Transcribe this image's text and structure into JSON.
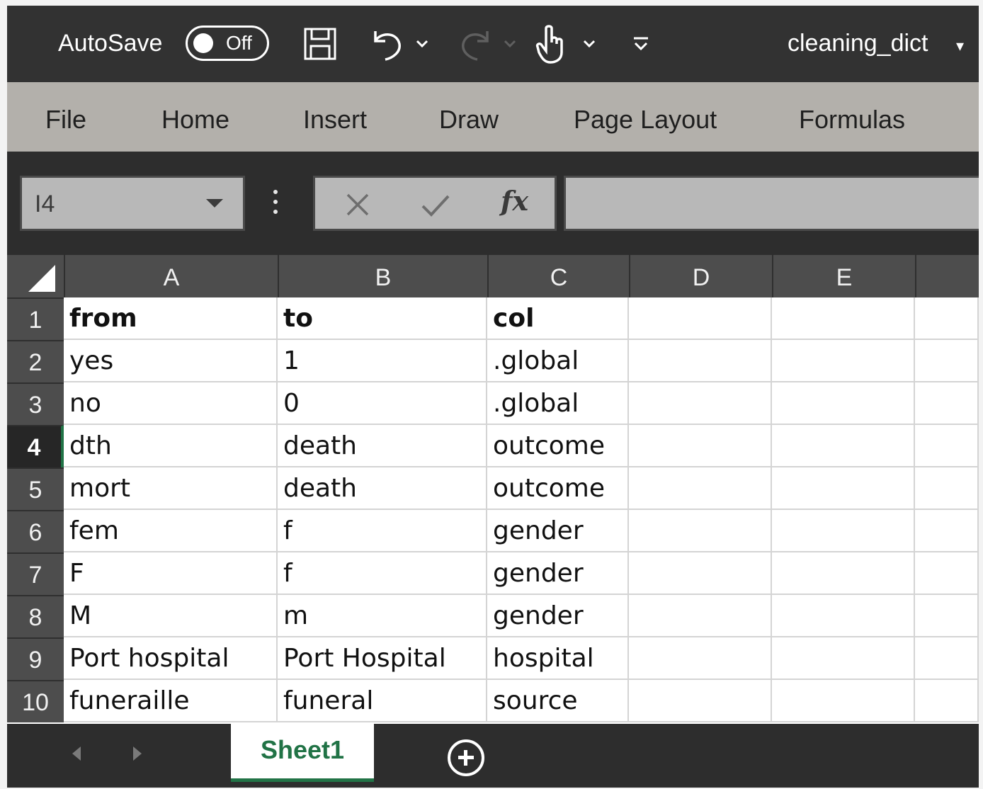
{
  "titlebar": {
    "autosave_label": "AutoSave",
    "autosave_state": "Off",
    "icons": [
      "save-icon",
      "undo-icon",
      "redo-icon",
      "touch-mode-icon",
      "customize-qat-icon"
    ],
    "doc_title": "cleaning_dict",
    "doc_caret": "▾"
  },
  "ribbon": {
    "tabs": [
      "File",
      "Home",
      "Insert",
      "Draw",
      "Page Layout",
      "Formulas"
    ]
  },
  "formula_bar": {
    "name_box": "I4",
    "fx_label": "fx",
    "content": ""
  },
  "grid": {
    "columns": [
      "A",
      "B",
      "C",
      "D",
      "E"
    ],
    "rows": [
      "1",
      "2",
      "3",
      "4",
      "5",
      "6",
      "7",
      "8",
      "9",
      "10"
    ],
    "active_row": "4",
    "cells": [
      [
        "from",
        "to",
        "col"
      ],
      [
        "yes",
        "1",
        ".global"
      ],
      [
        "no",
        "0",
        ".global"
      ],
      [
        "dth",
        "death",
        "outcome"
      ],
      [
        "mort",
        "death",
        "outcome"
      ],
      [
        "fem",
        "f",
        "gender"
      ],
      [
        "F",
        "f",
        "gender"
      ],
      [
        "M",
        "m",
        "gender"
      ],
      [
        "Port hospital",
        "Port Hospital",
        "hospital"
      ],
      [
        "funeraille",
        "funeral",
        "source"
      ]
    ]
  },
  "sheets": {
    "tabs": [
      "Sheet1"
    ],
    "accent": "#217346"
  }
}
